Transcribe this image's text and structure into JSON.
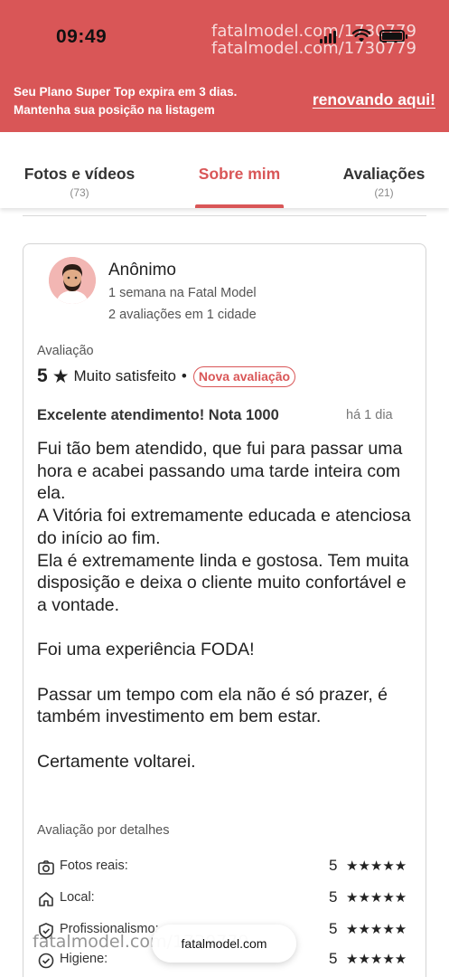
{
  "status_bar": {
    "time": "09:49",
    "watermark": "fatalmodel.com/1730779",
    "icons": [
      "signal-icon",
      "wifi-icon",
      "battery-icon"
    ]
  },
  "plan_banner": {
    "line1": "Seu Plano Super Top expira em 3 dias.",
    "line2": "Mantenha sua posição na listagem",
    "link": "renovando aqui!",
    "background": "#d95657"
  },
  "tabs": [
    {
      "label": "Fotos e vídeos",
      "count": "(73)",
      "active": false
    },
    {
      "label": "Sobre mim",
      "count": "",
      "active": true
    },
    {
      "label": "Avaliações",
      "count": "(21)",
      "active": false
    }
  ],
  "accent_color": "#d95657",
  "review": {
    "reviewer": "Anônimo",
    "tenure": "1 semana na Fatal Model",
    "stats": "2 avaliações em 1 cidade",
    "rating_caption": "Avaliação",
    "score": "5",
    "score_text": "Muito satisfeito",
    "dot": "•",
    "badge": "Nova avaliação",
    "title": "Excelente atendimento! Nota 1000",
    "time": "há 1 dia",
    "body": [
      "Fui tão bem atendido, que fui para passar uma hora e acabei passando uma tarde inteira com ela.",
      "A Vitória foi extremamente educada e atenciosa do início ao fim.",
      "Ela é extremamente linda e gostosa. Tem muita disposição e deixa o cliente muito confortável e a vontade.",
      "",
      "Foi uma experiência FODA!",
      "",
      "Passar um tempo com ela não é só prazer, é também investimento em bem estar.",
      "",
      "Certamente voltarei."
    ],
    "details_caption": "Avaliação por detalhes",
    "details": [
      {
        "icon": "camera-icon",
        "label": "Fotos reais:",
        "score": "5",
        "stars": "★★★★★"
      },
      {
        "icon": "home-icon",
        "label": "Local:",
        "score": "5",
        "stars": "★★★★★"
      },
      {
        "icon": "shield-check-icon",
        "label": "Profissionalismo:",
        "score": "5",
        "stars": "★★★★★"
      },
      {
        "icon": "check-circle-icon",
        "label": "Higiene:",
        "score": "5",
        "stars": "★★★★★"
      }
    ]
  },
  "bottom_pill": {
    "url": "fatalmodel.com",
    "watermark": "fatalmodel.com/1730779"
  }
}
